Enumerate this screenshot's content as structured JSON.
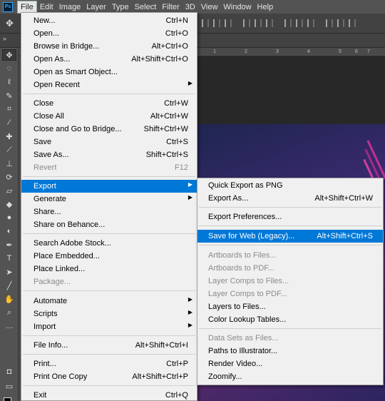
{
  "menubar": {
    "logo": "Ps",
    "items": [
      "File",
      "Edit",
      "Image",
      "Layer",
      "Type",
      "Select",
      "Filter",
      "3D",
      "View",
      "Window",
      "Help"
    ]
  },
  "file_menu": {
    "items": [
      {
        "label": "New...",
        "shortcut": "Ctrl+N"
      },
      {
        "label": "Open...",
        "shortcut": "Ctrl+O"
      },
      {
        "label": "Browse in Bridge...",
        "shortcut": "Alt+Ctrl+O"
      },
      {
        "label": "Open As...",
        "shortcut": "Alt+Shift+Ctrl+O"
      },
      {
        "label": "Open as Smart Object...",
        "shortcut": ""
      },
      {
        "label": "Open Recent",
        "shortcut": ""
      },
      {
        "label": "Close",
        "shortcut": "Ctrl+W"
      },
      {
        "label": "Close All",
        "shortcut": "Alt+Ctrl+W"
      },
      {
        "label": "Close and Go to Bridge...",
        "shortcut": "Shift+Ctrl+W"
      },
      {
        "label": "Save",
        "shortcut": "Ctrl+S"
      },
      {
        "label": "Save As...",
        "shortcut": "Shift+Ctrl+S"
      },
      {
        "label": "Revert",
        "shortcut": "F12"
      },
      {
        "label": "Export",
        "shortcut": ""
      },
      {
        "label": "Generate",
        "shortcut": ""
      },
      {
        "label": "Share...",
        "shortcut": ""
      },
      {
        "label": "Share on Behance...",
        "shortcut": ""
      },
      {
        "label": "Search Adobe Stock...",
        "shortcut": ""
      },
      {
        "label": "Place Embedded...",
        "shortcut": ""
      },
      {
        "label": "Place Linked...",
        "shortcut": ""
      },
      {
        "label": "Package...",
        "shortcut": ""
      },
      {
        "label": "Automate",
        "shortcut": ""
      },
      {
        "label": "Scripts",
        "shortcut": ""
      },
      {
        "label": "Import",
        "shortcut": ""
      },
      {
        "label": "File Info...",
        "shortcut": "Alt+Shift+Ctrl+I"
      },
      {
        "label": "Print...",
        "shortcut": "Ctrl+P"
      },
      {
        "label": "Print One Copy",
        "shortcut": "Alt+Shift+Ctrl+P"
      },
      {
        "label": "Exit",
        "shortcut": "Ctrl+Q"
      }
    ]
  },
  "export_menu": {
    "items": [
      {
        "label": "Quick Export as PNG",
        "shortcut": ""
      },
      {
        "label": "Export As...",
        "shortcut": "Alt+Shift+Ctrl+W"
      },
      {
        "label": "Export Preferences...",
        "shortcut": ""
      },
      {
        "label": "Save for Web (Legacy)...",
        "shortcut": "Alt+Shift+Ctrl+S"
      },
      {
        "label": "Artboards to Files...",
        "shortcut": ""
      },
      {
        "label": "Artboards to PDF...",
        "shortcut": ""
      },
      {
        "label": "Layer Comps to Files...",
        "shortcut": ""
      },
      {
        "label": "Layer Comps to PDF...",
        "shortcut": ""
      },
      {
        "label": "Layers to Files...",
        "shortcut": ""
      },
      {
        "label": "Color Lookup Tables...",
        "shortcut": ""
      },
      {
        "label": "Data Sets as Files...",
        "shortcut": ""
      },
      {
        "label": "Paths to Illustrator...",
        "shortcut": ""
      },
      {
        "label": "Render Video...",
        "shortcut": ""
      },
      {
        "label": "Zoomify...",
        "shortcut": ""
      }
    ]
  },
  "ruler": {
    "ticks": [
      "1",
      "2",
      "3",
      "4",
      "5",
      "6",
      "7"
    ]
  },
  "colors": {
    "highlight": "#0078d7",
    "menu_bg": "#f0f0f0",
    "disabled_text": "#8a8a8a"
  }
}
